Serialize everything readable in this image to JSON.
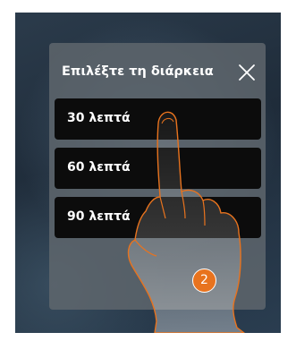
{
  "dialog": {
    "title": "Επιλέξτε τη διάρκεια",
    "close_icon": "close-icon"
  },
  "options": [
    {
      "label": "30 λεπτά"
    },
    {
      "label": "60 λεπτά"
    },
    {
      "label": "90 λεπτά"
    }
  ],
  "step_badge": "2",
  "colors": {
    "accent": "#e8731e",
    "option_bg": "#0c0c0c",
    "dialog_bg": "#60686e"
  }
}
